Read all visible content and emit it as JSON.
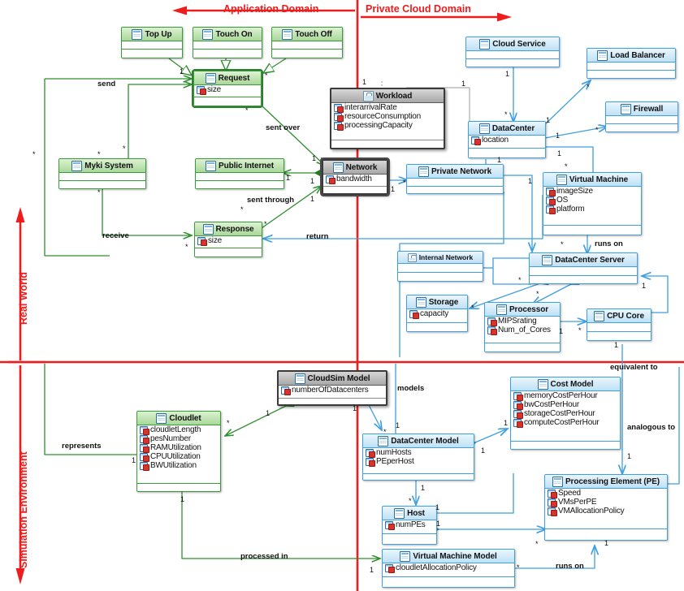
{
  "domains": {
    "application": "Application Domain",
    "private_cloud": "Private Cloud Domain",
    "real_world": "Real World",
    "simulation": "Simulation Environment"
  },
  "colors": {
    "domain_label": "#ee1c1c",
    "green_border": "#3a9b3a",
    "blue_border": "#3f9fe0",
    "gray_border": "#3a3a3a",
    "green_edge": "#2f8f2f",
    "blue_edge": "#3f9fe0",
    "divider": "#ee1c1c"
  },
  "classes": [
    {
      "id": "topup",
      "name": "Top Up",
      "style": "green",
      "icon": "class-icon",
      "attrs": []
    },
    {
      "id": "touchon",
      "name": "Touch On",
      "style": "green",
      "icon": "class-icon",
      "attrs": []
    },
    {
      "id": "touchoff",
      "name": "Touch Off",
      "style": "green",
      "icon": "class-icon",
      "attrs": []
    },
    {
      "id": "request",
      "name": "Request",
      "style": "green",
      "icon": "class-icon",
      "attrs": [
        "size"
      ],
      "selected": true
    },
    {
      "id": "myki",
      "name": "Myki System",
      "style": "green",
      "icon": "class-icon",
      "attrs": []
    },
    {
      "id": "publicnet",
      "name": "Public Internet",
      "style": "green",
      "icon": "class-icon",
      "attrs": []
    },
    {
      "id": "response",
      "name": "Response",
      "style": "green",
      "icon": "class-icon",
      "attrs": [
        "size"
      ]
    },
    {
      "id": "workload",
      "name": "Workload",
      "style": "gray",
      "icon": "interface-icon",
      "attrs": [
        "interarrivalRate",
        "resourceConsumption",
        "processingCapacity"
      ]
    },
    {
      "id": "network",
      "name": "Network",
      "style": "gray",
      "icon": "class-icon",
      "attrs": [
        "bandwidth"
      ]
    },
    {
      "id": "cloudsvc",
      "name": "Cloud Service",
      "style": "blue",
      "icon": "class-icon",
      "attrs": []
    },
    {
      "id": "loadbal",
      "name": "Load Balancer",
      "style": "blue",
      "icon": "class-icon",
      "attrs": []
    },
    {
      "id": "firewall",
      "name": "Firewall",
      "style": "blue",
      "icon": "class-icon",
      "attrs": []
    },
    {
      "id": "datacenter",
      "name": "DataCenter",
      "style": "blue",
      "icon": "class-icon",
      "attrs": [
        "location"
      ]
    },
    {
      "id": "privnet",
      "name": "Private Network",
      "style": "blue",
      "icon": "class-icon",
      "attrs": []
    },
    {
      "id": "vm",
      "name": "Virtual Machine",
      "style": "blue",
      "icon": "class-icon",
      "attrs": [
        "imageSize",
        "OS",
        "platform"
      ]
    },
    {
      "id": "intnet",
      "name": "Internal Network",
      "style": "blue",
      "icon": "interface-icon",
      "attrs": []
    },
    {
      "id": "dcserver",
      "name": "DataCenter Server",
      "style": "blue",
      "icon": "class-icon",
      "attrs": []
    },
    {
      "id": "storage",
      "name": "Storage",
      "style": "blue",
      "icon": "class-icon",
      "attrs": [
        "capacity"
      ]
    },
    {
      "id": "processor",
      "name": "Processor",
      "style": "blue",
      "icon": "class-icon",
      "attrs": [
        "MIPSrating",
        "Num_of_Cores"
      ]
    },
    {
      "id": "cpucore",
      "name": "CPU Core",
      "style": "blue",
      "icon": "class-icon",
      "attrs": []
    },
    {
      "id": "cloudsim",
      "name": "CloudSim Model",
      "style": "gray",
      "icon": "class-icon",
      "attrs": [
        "numberOfDatacenters"
      ]
    },
    {
      "id": "cloudlet",
      "name": "Cloudlet",
      "style": "green",
      "icon": "class-icon",
      "attrs": [
        "cloudletLength",
        "pesNumber",
        "RAMUtilization",
        "CPUUtilization",
        "BWUtilization"
      ]
    },
    {
      "id": "costmodel",
      "name": "Cost Model",
      "style": "blue",
      "icon": "class-icon",
      "attrs": [
        "memoryCostPerHour",
        "bwCostPerHour",
        "storageCostPerHour",
        "computeCostPerHour"
      ]
    },
    {
      "id": "dcmodel",
      "name": "DataCenter Model",
      "style": "blue",
      "icon": "class-icon",
      "attrs": [
        "numHosts",
        "PEperHost"
      ]
    },
    {
      "id": "host",
      "name": "Host",
      "style": "blue",
      "icon": "class-icon",
      "attrs": [
        "numPEs"
      ]
    },
    {
      "id": "pe",
      "name": "Processing Element (PE)",
      "style": "blue",
      "icon": "class-icon",
      "attrs": [
        "Speed",
        "VMsPerPE",
        "VMAllocationPolicy"
      ]
    },
    {
      "id": "vmmodel",
      "name": "Virtual Machine Model",
      "style": "blue",
      "icon": "class-icon",
      "attrs": [
        "cloudletAllocationPolicy"
      ]
    }
  ],
  "edge_labels": [
    {
      "id": "send",
      "text": "send"
    },
    {
      "id": "sent_over",
      "text": "sent over"
    },
    {
      "id": "sent_through",
      "text": "sent through"
    },
    {
      "id": "receive",
      "text": "receive"
    },
    {
      "id": "return",
      "text": "return"
    },
    {
      "id": "runs_on_vm",
      "text": "runs on"
    },
    {
      "id": "models",
      "text": "models"
    },
    {
      "id": "represents",
      "text": "represents"
    },
    {
      "id": "processed_in",
      "text": "processed in"
    },
    {
      "id": "runs_on_vmm",
      "text": "runs on"
    },
    {
      "id": "equivalent",
      "text": "equivalent to"
    },
    {
      "id": "analogous",
      "text": "analogous to"
    }
  ],
  "multiplicities": [
    "1",
    "*",
    "1",
    "*",
    "1",
    "*",
    "1",
    "1",
    "1",
    "*",
    "1",
    "1",
    "*",
    "1",
    "*",
    "1",
    "1",
    "*",
    "1",
    "*",
    "1",
    "*",
    "1",
    "1",
    "*",
    "1",
    "*",
    "1",
    "*",
    "1",
    "1",
    "*",
    "1",
    "1",
    "*",
    "1",
    "1",
    "*",
    "1",
    "1",
    "*",
    "1",
    "1",
    "*",
    "1",
    "1",
    "*",
    "1",
    "*",
    "1"
  ]
}
